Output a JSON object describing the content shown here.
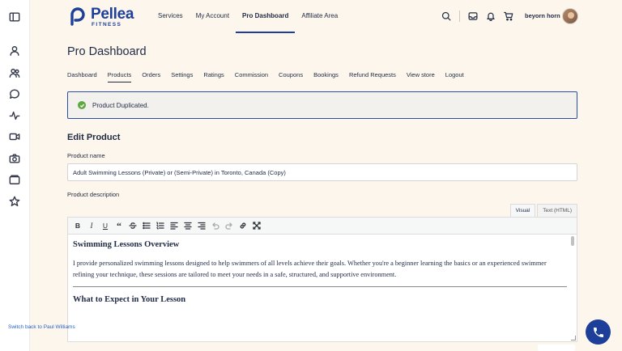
{
  "brand": {
    "name": "Pellea",
    "sub": "FITNESS",
    "color": "#1d3f9a"
  },
  "topnav": [
    {
      "label": "Services"
    },
    {
      "label": "My Account"
    },
    {
      "label": "Pro Dashboard",
      "active": true
    },
    {
      "label": "Affiliate Area"
    }
  ],
  "header_icons": [
    "search-icon",
    "inbox-icon",
    "bell-icon",
    "cart-icon"
  ],
  "user": {
    "name": "beyorn horn"
  },
  "rail_icons": [
    "sidebar-toggle-icon",
    "user-icon",
    "users-icon",
    "chat-icon",
    "activity-icon",
    "video-icon",
    "camera-icon",
    "folder-icon",
    "star-icon"
  ],
  "page": {
    "title": "Pro Dashboard"
  },
  "subnav": [
    {
      "label": "Dashboard"
    },
    {
      "label": "Products",
      "active": true
    },
    {
      "label": "Orders"
    },
    {
      "label": "Settings"
    },
    {
      "label": "Ratings"
    },
    {
      "label": "Commission"
    },
    {
      "label": "Coupons"
    },
    {
      "label": "Bookings"
    },
    {
      "label": "Refund Requests"
    },
    {
      "label": "View store"
    },
    {
      "label": "Logout"
    }
  ],
  "notice": {
    "message": "Product Duplicated.",
    "color": "#5fa843"
  },
  "form": {
    "section_title": "Edit Product",
    "name_label": "Product name",
    "name_value": "Adult Swimming Lessons (Private) or (Semi-Private) in Toronto, Canada (Copy)",
    "description_label": "Product description"
  },
  "editor": {
    "tabs": [
      {
        "label": "Visual",
        "active": true
      },
      {
        "label": "Text (HTML)"
      }
    ],
    "toolbar": [
      "bold",
      "italic",
      "underline",
      "blockquote",
      "strikethrough",
      "bullet-list",
      "numbered-list",
      "align-left",
      "align-center",
      "align-right",
      "undo",
      "redo",
      "link",
      "fullscreen"
    ],
    "content": {
      "heading1": "Swimming Lessons Overview",
      "paragraph1": "I provide personalized swimming lessons designed to help swimmers of all levels achieve their goals. Whether you're a beginner learning the basics or an experienced swimmer refining your technique, these sessions are tailored to meet your needs in a safe, structured, and supportive environment.",
      "heading2": "What to Expect in Your Lesson"
    }
  },
  "switch_back": {
    "label": "Switch back to Paul Williams"
  }
}
